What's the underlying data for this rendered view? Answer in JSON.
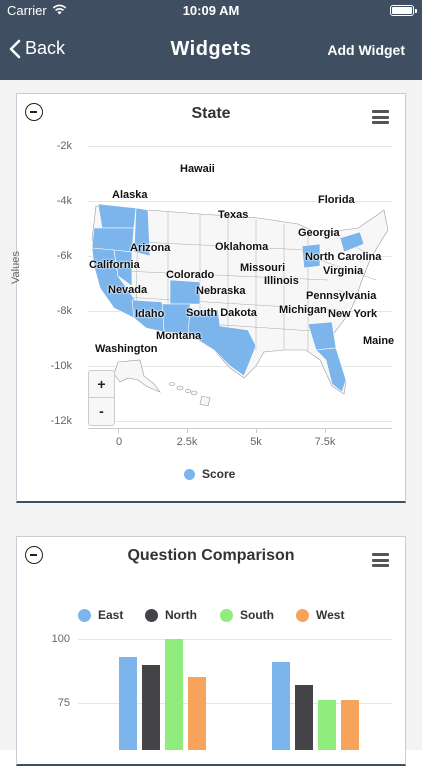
{
  "status_bar": {
    "carrier": "Carrier",
    "time": "10:09 AM"
  },
  "nav": {
    "back_label": "Back",
    "title": "Widgets",
    "action_label": "Add Widget"
  },
  "state_widget": {
    "title": "State",
    "y_axis_title": "Values",
    "y_ticks": [
      "-2k",
      "-4k",
      "-6k",
      "-8k",
      "-10k",
      "-12k"
    ],
    "x_ticks": [
      "0",
      "2.5k",
      "5k",
      "7.5k"
    ],
    "zoom_in_label": "+",
    "zoom_out_label": "-",
    "legend_label": "Score",
    "legend_color": "#7cb5ec",
    "state_labels": [
      "Hawaii",
      "Alaska",
      "Florida",
      "Texas",
      "Georgia",
      "Arizona",
      "Oklahoma",
      "North Carolina",
      "California",
      "Missouri",
      "Virginia",
      "Colorado",
      "Illinois",
      "Nevada",
      "Nebraska",
      "Pennsylvania",
      "Idaho",
      "South Dakota",
      "Michigan",
      "New York",
      "Montana",
      "Maine",
      "Washington"
    ]
  },
  "comparison_widget": {
    "title": "Question Comparison",
    "y_ticks": [
      "100",
      "75"
    ],
    "chart_data": {
      "type": "bar",
      "series": [
        {
          "name": "East",
          "color": "#7cb5ec",
          "values": [
            93,
            91
          ]
        },
        {
          "name": "North",
          "color": "#434348",
          "values": [
            90,
            82
          ]
        },
        {
          "name": "South",
          "color": "#90ed7d",
          "values": [
            100,
            76
          ]
        },
        {
          "name": "West",
          "color": "#f7a35c",
          "values": [
            85,
            76
          ]
        }
      ]
    }
  }
}
